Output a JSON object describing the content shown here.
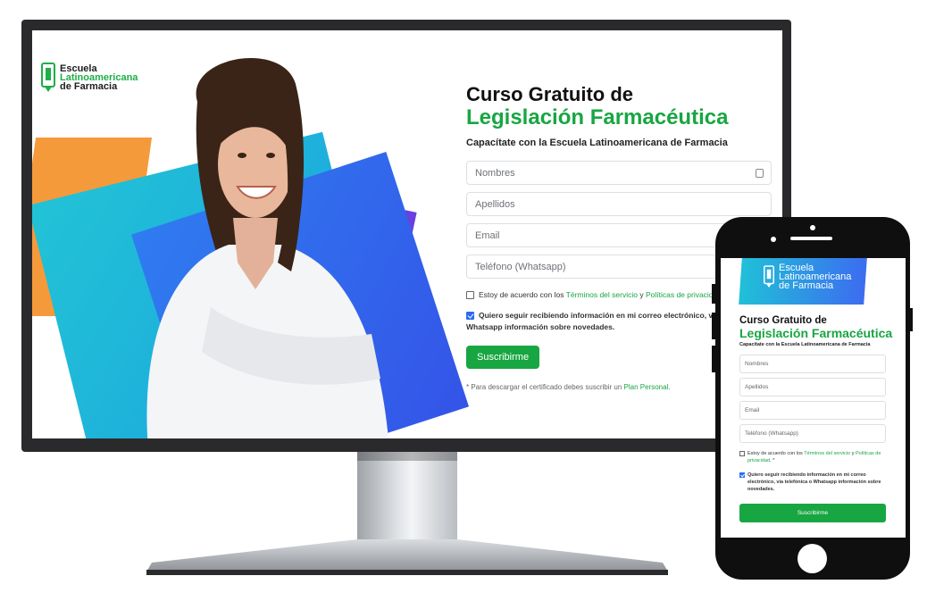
{
  "brand": {
    "line1": "Escuela",
    "line2": "Latinoamericana",
    "line3": "de Farmacia",
    "green": "#18a642",
    "blue": "#2f7cf0"
  },
  "desktop": {
    "title_line1": "Curso Gratuito de",
    "title_line2": "Legislación Farmacéutica",
    "subtitle": "Capacítate con la Escuela Latinoamericana de Farmacia",
    "fields": {
      "nombres": "Nombres",
      "apellidos": "Apellidos",
      "email": "Email",
      "telefono": "Teléfono (Whatsapp)"
    },
    "terms": {
      "prefix": "Estoy de acuerdo con los ",
      "link1": "Términos del servicio",
      "middle": " y ",
      "link2": "Políticas de privacidad"
    },
    "optin": {
      "line1": "Quiero seguir recibiendo información en mi correo electrónico, vía",
      "line2": "Whatsapp información sobre novedades."
    },
    "submit": "Suscribirme",
    "note": {
      "prefix": "* Para descargar el certificado debes suscribir un ",
      "link": "Plan Personal",
      "suffix": "."
    }
  },
  "mobile": {
    "title_line1": "Curso Gratuito de",
    "title_line2": "Legislación Farmacéutica",
    "subtitle": "Capacítate con la Escuela Latinoamericana de Farmacia",
    "fields": {
      "nombres": "Nombres",
      "apellidos": "Apellidos",
      "email": "Email",
      "telefono": "Teléfono (Whatsapp)"
    },
    "terms": {
      "prefix": "Estoy de acuerdo con los ",
      "link1": "Términos del servicio",
      "middle": " y ",
      "link2": "Políticas de privacidad",
      "suffix": ". *"
    },
    "optin": "Quiero seguir recibiendo información en mi correo electrónico, vía telefónica o Whatsapp información sobre novedades.",
    "submit": "Suscribirme"
  }
}
